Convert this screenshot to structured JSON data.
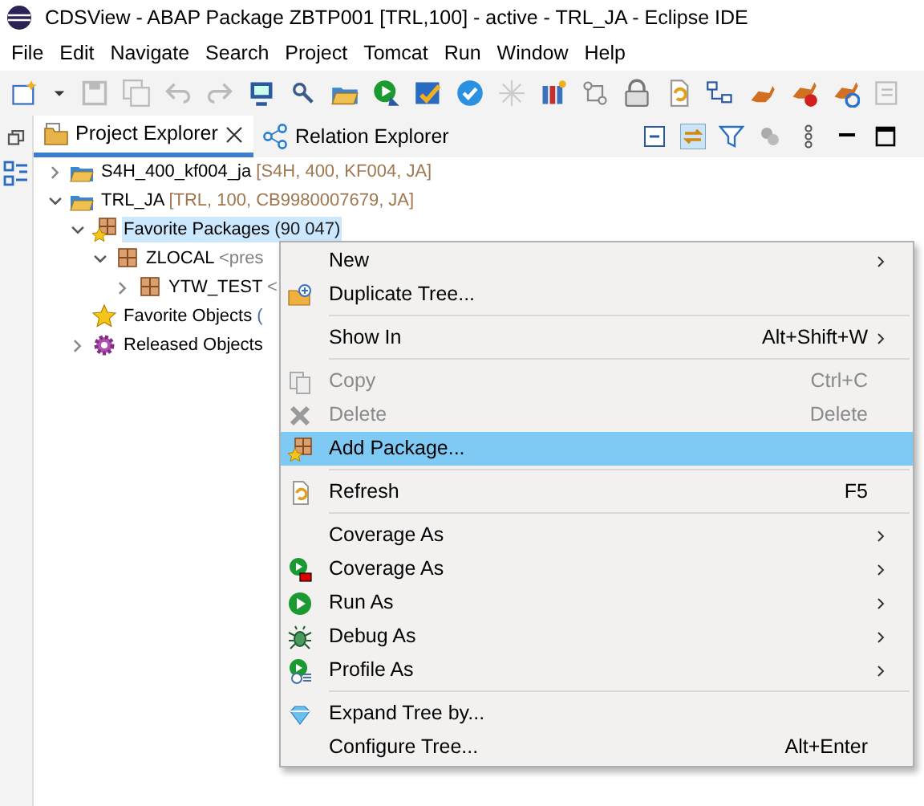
{
  "window": {
    "title": "CDSView - ABAP Package ZBTP001 [TRL,100] - active - TRL_JA - Eclipse IDE"
  },
  "menu_bar": [
    "File",
    "Edit",
    "Navigate",
    "Search",
    "Project",
    "Tomcat",
    "Run",
    "Window",
    "Help"
  ],
  "tabs": [
    {
      "label": "Project Explorer",
      "selected": true,
      "closable": true
    },
    {
      "label": "Relation Explorer",
      "selected": false,
      "closable": false
    }
  ],
  "tree": [
    {
      "kind": "project",
      "label": "S4H_400_kf004_ja",
      "detail": "[S4H, 400, KF004, JA]",
      "expanded": false,
      "selected": false
    },
    {
      "kind": "project",
      "label": "TRL_JA",
      "detail": "[TRL, 100, CB9980007679, JA]",
      "expanded": true,
      "selected": false,
      "children": [
        {
          "kind": "favorite-packages",
          "label": "Favorite Packages",
          "detail": "(90 047)",
          "expanded": true,
          "selected": true,
          "children": [
            {
              "kind": "package",
              "label": "ZLOCAL",
              "detail": "<pres",
              "expanded": true,
              "selected": false,
              "children": [
                {
                  "kind": "package",
                  "label": "YTW_TEST",
                  "detail": "<",
                  "expanded": false,
                  "selected": false
                }
              ]
            }
          ]
        },
        {
          "kind": "favorite-objects",
          "label": "Favorite Objects",
          "detail": "(",
          "expandable": false,
          "selected": false
        },
        {
          "kind": "released",
          "label": "Released Objects",
          "expanded": false,
          "selected": false
        }
      ]
    }
  ],
  "context_menu": [
    {
      "kind": "item",
      "label": "New",
      "submenu": true,
      "disabled": false,
      "selected": false
    },
    {
      "kind": "item",
      "label": "Duplicate Tree...",
      "submenu": false,
      "disabled": false,
      "selected": false
    },
    {
      "kind": "separator"
    },
    {
      "kind": "item",
      "label": "Show In",
      "shortcut": "Alt+Shift+W",
      "submenu": true,
      "disabled": false,
      "selected": false
    },
    {
      "kind": "separator"
    },
    {
      "kind": "item",
      "label": "Copy",
      "shortcut": "Ctrl+C",
      "submenu": false,
      "disabled": true,
      "selected": false
    },
    {
      "kind": "item",
      "label": "Delete",
      "shortcut": "Delete",
      "submenu": false,
      "disabled": true,
      "selected": false
    },
    {
      "kind": "item",
      "label": "Add Package...",
      "submenu": false,
      "disabled": false,
      "selected": true
    },
    {
      "kind": "separator"
    },
    {
      "kind": "item",
      "label": "Refresh",
      "shortcut": "F5",
      "submenu": false,
      "disabled": false,
      "selected": false
    },
    {
      "kind": "separator"
    },
    {
      "kind": "item",
      "label": "Coverage As",
      "submenu": true,
      "disabled": false,
      "selected": false
    },
    {
      "kind": "item",
      "label": "Coverage As",
      "submenu": true,
      "disabled": false,
      "selected": false
    },
    {
      "kind": "item",
      "label": "Run As",
      "submenu": true,
      "disabled": false,
      "selected": false
    },
    {
      "kind": "item",
      "label": "Debug As",
      "submenu": true,
      "disabled": false,
      "selected": false
    },
    {
      "kind": "item",
      "label": "Profile As",
      "submenu": true,
      "disabled": false,
      "selected": false
    },
    {
      "kind": "separator"
    },
    {
      "kind": "item",
      "label": "Expand Tree by...",
      "submenu": false,
      "disabled": false,
      "selected": false
    },
    {
      "kind": "item",
      "label": "Configure Tree...",
      "shortcut": "Alt+Enter",
      "submenu": false,
      "disabled": false,
      "selected": false
    }
  ]
}
